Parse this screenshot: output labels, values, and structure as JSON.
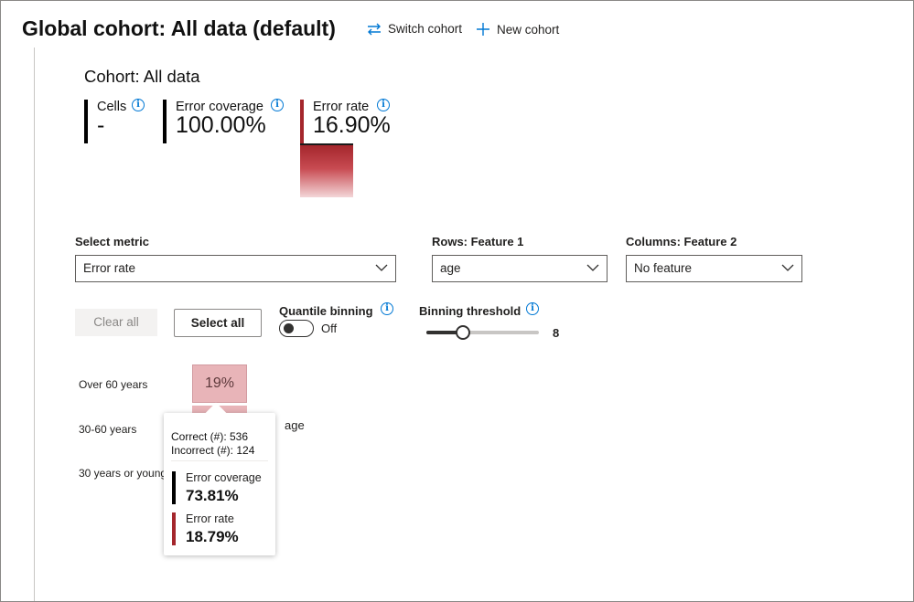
{
  "header": {
    "title": "Global cohort: All data (default)",
    "switch_cohort": "Switch cohort",
    "new_cohort": "New cohort"
  },
  "cohort": {
    "name": "Cohort: All data",
    "cells_label": "Cells",
    "cells_value": "-",
    "error_coverage_label": "Error coverage",
    "error_coverage_value": "100.00%",
    "error_rate_label": "Error rate",
    "error_rate_value": "16.90%"
  },
  "filters": {
    "select_metric_label": "Select metric",
    "select_metric_value": "Error rate",
    "rows_label": "Rows: Feature 1",
    "rows_value": "age",
    "columns_label": "Columns: Feature 2",
    "columns_value": "No feature"
  },
  "controls": {
    "clear_all": "Clear all",
    "select_all": "Select all",
    "quantile_binning_label": "Quantile binning",
    "quantile_binning_state": "Off",
    "binning_threshold_label": "Binning threshold",
    "binning_threshold_value": "8"
  },
  "heatmap": {
    "rows": [
      "Over 60 years",
      "30-60 years",
      "30 years or younger"
    ],
    "cell_value": "19%",
    "axis_label": "age"
  },
  "tooltip": {
    "correct": "Correct (#): 536",
    "incorrect": "Incorrect (#): 124",
    "error_coverage_label": "Error coverage",
    "error_coverage_value": "73.81%",
    "error_rate_label": "Error rate",
    "error_rate_value": "18.79%"
  },
  "colors": {
    "accent": "#0078d4",
    "error": "#a4262c",
    "cell": "#e8b4b8"
  }
}
